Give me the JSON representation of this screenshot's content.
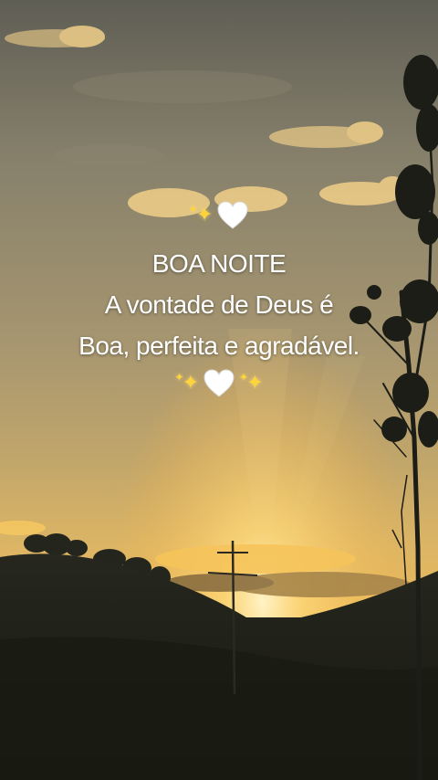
{
  "message": {
    "line1": "BOA NOITE",
    "line2": "A vontade de Deus é",
    "line3": "Boa, perfeita e agradável."
  },
  "decorations": {
    "sparkle_icon": "sparkles-emoji",
    "heart_icon": "white-heart-emoji",
    "heart_color": "#ffffff",
    "sparkle_color": "#ffd43b"
  },
  "colors": {
    "sky_top": "#6f6c5f",
    "sky_mid": "#a99a6c",
    "sky_glow": "#f2c255",
    "hills": "#1f211c"
  }
}
